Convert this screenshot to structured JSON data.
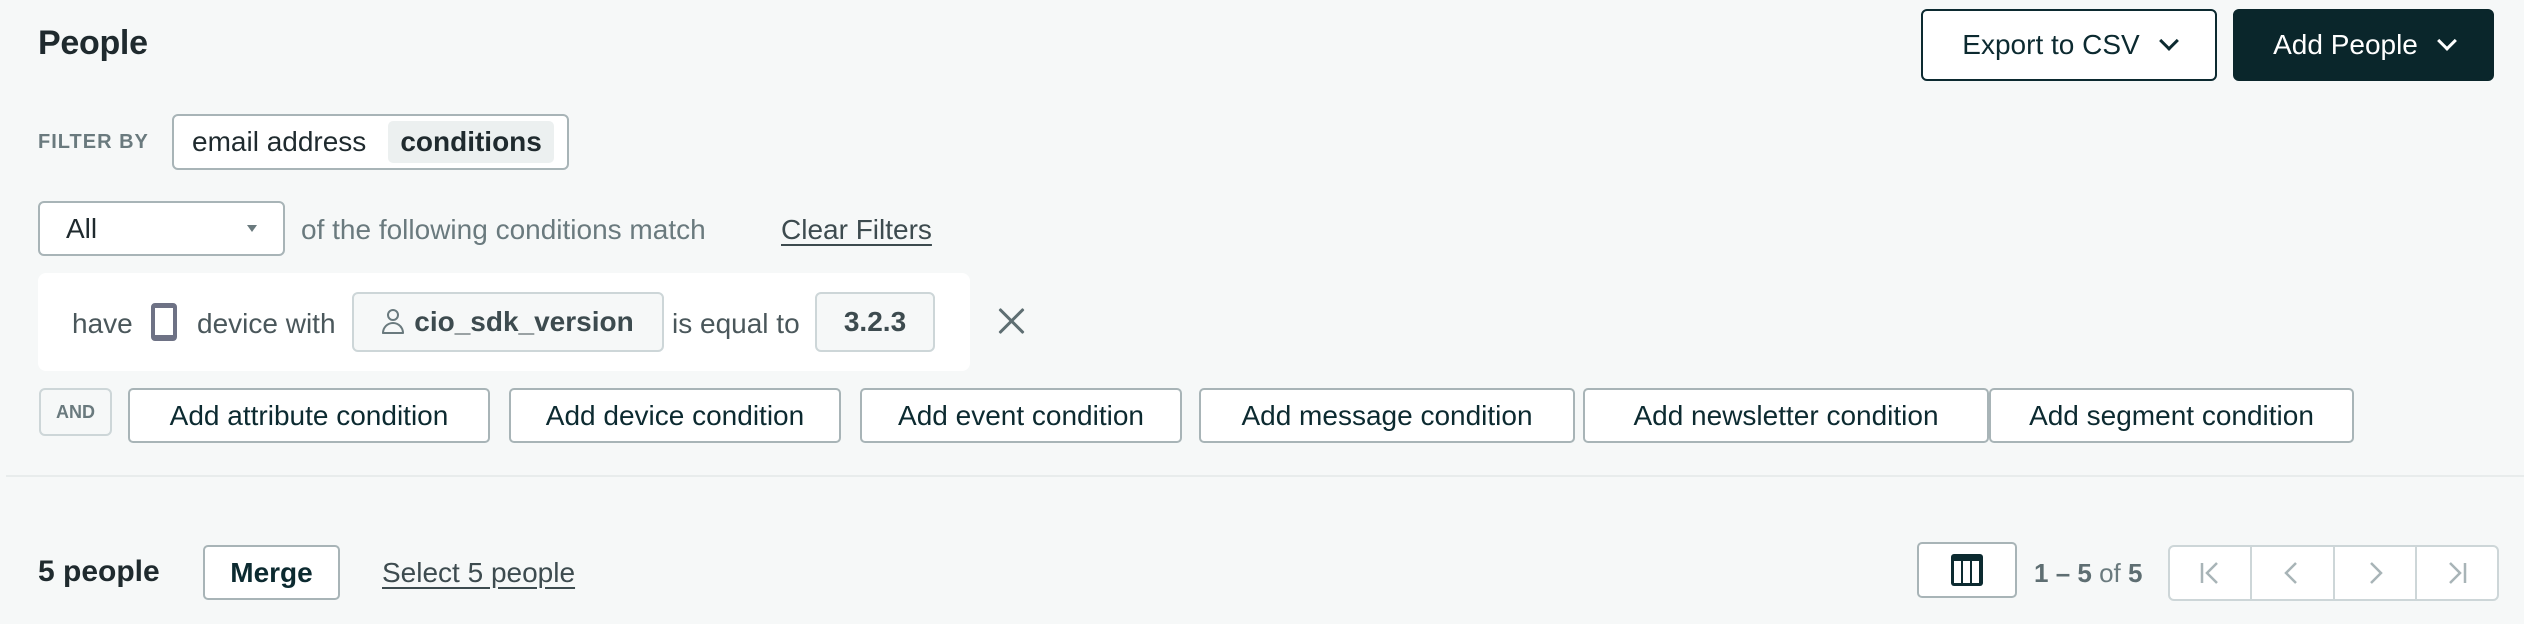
{
  "header": {
    "title": "People",
    "export_button": "Export to CSV",
    "add_people_button": "Add People"
  },
  "filter": {
    "label": "FILTER BY",
    "options": [
      "email address",
      "conditions"
    ],
    "active_option": "conditions"
  },
  "match": {
    "selected": "All",
    "suffix_text": "of the following conditions match",
    "clear_link": "Clear Filters"
  },
  "condition": {
    "prefix": "have",
    "device_icon": "phone-icon",
    "device_text": "device with",
    "attribute_icon": "person-icon",
    "attribute": "cio_sdk_version",
    "operator": "is equal to",
    "value": "3.2.3",
    "remove_icon": "close-icon"
  },
  "add_conditions": {
    "joiner": "AND",
    "buttons": [
      "Add attribute condition",
      "Add device condition",
      "Add event condition",
      "Add message condition",
      "Add newsletter condition",
      "Add segment condition"
    ]
  },
  "footer": {
    "count_text": "5 people",
    "merge_button": "Merge",
    "select_link": "Select 5 people",
    "columns_icon": "columns-icon",
    "range_start": "1",
    "range_end": "5",
    "range_of": "of",
    "total": "5",
    "pager": [
      "first-page",
      "previous-page",
      "next-page",
      "last-page"
    ]
  },
  "colors": {
    "background": "#f6f8f8",
    "primary_dark": "#0a262b",
    "border": "#a8b4b7",
    "muted_text": "#6a7a7e"
  }
}
